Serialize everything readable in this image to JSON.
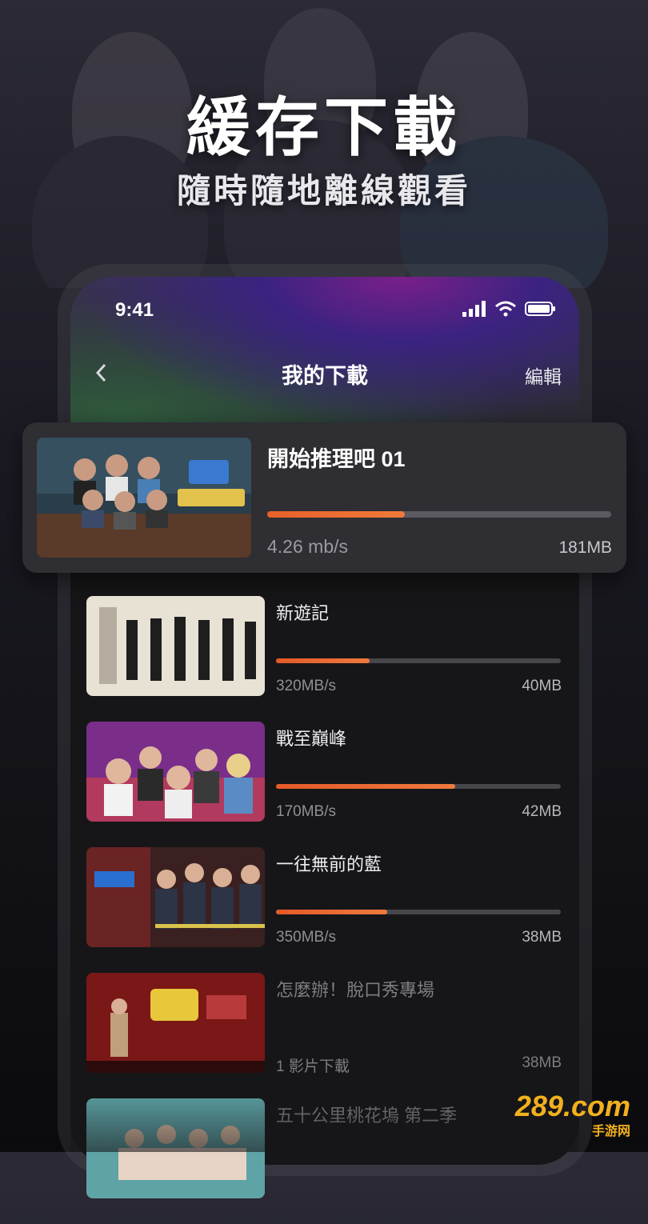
{
  "promo": {
    "title": "緩存下載",
    "subtitle": "隨時隨地離線觀看"
  },
  "status_bar": {
    "time": "9:41",
    "icons": [
      "signal-icon",
      "wifi-icon",
      "battery-icon"
    ]
  },
  "nav": {
    "back_icon": "chevron-left-icon",
    "title": "我的下載",
    "edit_label": "編輯"
  },
  "highlight": {
    "title": "開始推理吧 01",
    "speed": "4.26 mb/s",
    "size": "181MB",
    "progress": 0.4
  },
  "downloads": [
    {
      "title": "新遊記",
      "speed": "320MB/s",
      "size": "40MB",
      "progress": 0.33
    },
    {
      "title": "戰至巔峰",
      "speed": "170MB/s",
      "size": "42MB",
      "progress": 0.63
    },
    {
      "title": "一往無前的藍",
      "speed": "350MB/s",
      "size": "38MB",
      "progress": 0.39
    },
    {
      "title": "怎麼辦！脫口秀專場",
      "speed": "1 影片下載",
      "size": "38MB"
    },
    {
      "title": "五十公里桃花塢 第二季"
    }
  ],
  "colors": {
    "accent": "#ee6a30",
    "background": "#161618"
  },
  "watermark": {
    "brand": "289.com",
    "tagline": "手游网"
  }
}
